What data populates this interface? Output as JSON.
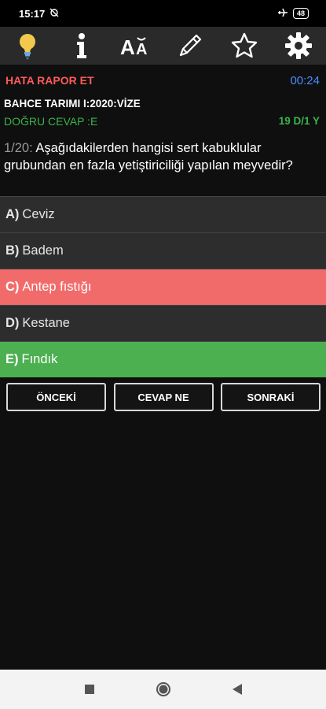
{
  "status": {
    "time": "15:17",
    "battery": "48"
  },
  "toolbar": {
    "icons": [
      "lightbulb-icon",
      "info-icon",
      "font-size-icon",
      "pencil-icon",
      "star-icon",
      "gear-icon"
    ]
  },
  "header": {
    "report": "HATA RAPOR ET",
    "timer": "00:24"
  },
  "exam": {
    "title": "BAHCE TARIMI I:2020:VİZE",
    "correct": "DOĞRU CEVAP :E",
    "score": "19 D/1 Y"
  },
  "question": {
    "number": "1/20:",
    "text": "Aşağıdakilerden hangisi sert kabuklular grubundan en fazla yetiştiriciliği yapılan meyvedir?"
  },
  "options": [
    {
      "key": "A)",
      "text": "Ceviz",
      "state": "normal"
    },
    {
      "key": "B)",
      "text": "Badem",
      "state": "normal"
    },
    {
      "key": "C)",
      "text": "Antep fıstığı",
      "state": "wrong"
    },
    {
      "key": "D)",
      "text": "Kestane",
      "state": "normal"
    },
    {
      "key": "E)",
      "text": "Fındık",
      "state": "right"
    }
  ],
  "buttons": {
    "prev": "ÖNCEKİ",
    "answer": "CEVAP NE",
    "next": "SONRAKİ"
  },
  "colors": {
    "wrong": "#f26b6b",
    "right": "#4caf50",
    "report": "#ff5a5a",
    "timer": "#4a8cff"
  }
}
